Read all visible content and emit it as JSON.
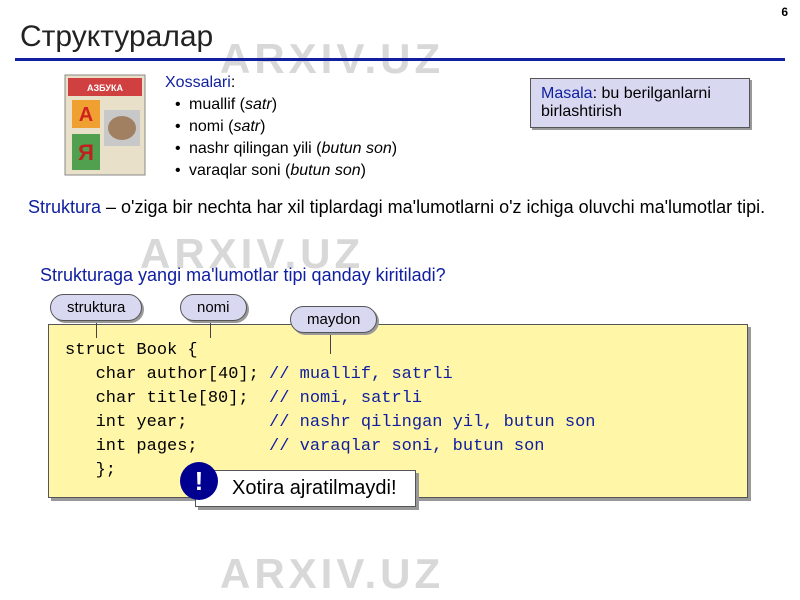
{
  "page_number": "6",
  "watermark": "ARXIV.UZ",
  "title": "Структуралар",
  "xossalari": {
    "label": "Xossalari",
    "items": [
      {
        "text": "muallif (",
        "type": "satr",
        "close": ")"
      },
      {
        "text": "nomi (",
        "type": "satr",
        "close": ")"
      },
      {
        "text": "nashr qilingan yili (",
        "type": "butun son",
        "close": ")"
      },
      {
        "text": "varaqlar soni (",
        "type": "butun son",
        "close": ")"
      }
    ]
  },
  "masala": {
    "label": "Masala",
    "text": ": bu berilganlarni birlashtirish"
  },
  "definition": {
    "term": "Struktura",
    "text": " – o'ziga bir nechta har xil tiplardagi ma'lumotlarni o'z ichiga oluvchi ma'lumotlar tipi."
  },
  "question": "Strukturaga yangi ma'lumotlar tipi qanday kiritiladi?",
  "pills": {
    "struktura": "struktura",
    "nomi": "nomi",
    "maydon": "maydon"
  },
  "code": {
    "l1": "struct Book {",
    "l2a": "   char author[40]; ",
    "l2b": "// muallif, satrli",
    "l3a": "   char title[80];  ",
    "l3b": "// nomi, satrli",
    "l4a": "   int year;        ",
    "l4b": "// nashr qilingan yil, butun son",
    "l5a": "   int pages;       ",
    "l5b": "// varaqlar soni, butun son",
    "l6": "   };"
  },
  "warning": {
    "badge": "!",
    "text": "Xotira ajratilmaydi!"
  },
  "book_image": {
    "top_label": "АЗБУКА",
    "letter1": "А",
    "letter2": "Я"
  }
}
